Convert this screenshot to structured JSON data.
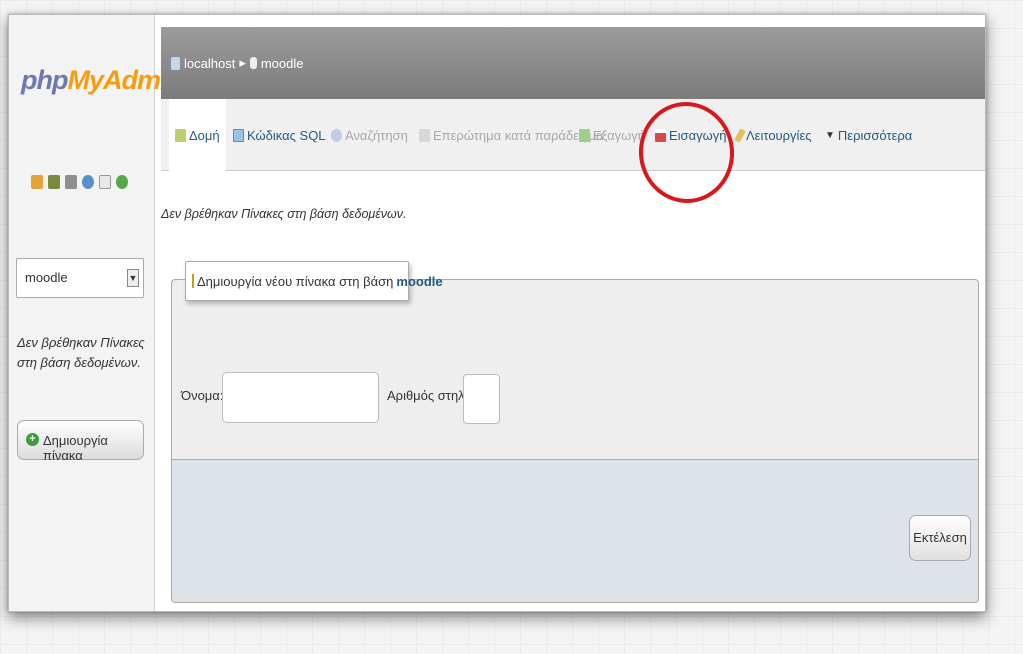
{
  "sidebar": {
    "logo": {
      "php": "php",
      "my": "My",
      "admin": "Admin"
    },
    "db_select_value": "moodle",
    "no_tables_msg": "Δεν βρέθηκαν Πίνακες στη βάση δεδομένων.",
    "create_table_label": "Δημιουργία πίνακα"
  },
  "breadcrumb": {
    "server": "localhost",
    "database": "moodle"
  },
  "tabs": [
    {
      "label": "Δομή",
      "icon": "structure-icon",
      "state": "active"
    },
    {
      "label": "Κώδικας SQL",
      "icon": "sql-icon",
      "state": "normal"
    },
    {
      "label": "Αναζήτηση",
      "icon": "search-icon",
      "state": "disabled"
    },
    {
      "label": "Επερώτημα κατά παράδειγμα",
      "icon": "query-icon",
      "state": "disabled"
    },
    {
      "label": "Εξαγωγή",
      "icon": "export-icon",
      "state": "disabled"
    },
    {
      "label": "Εισαγωγή",
      "icon": "import-icon",
      "state": "normal"
    },
    {
      "label": "Λειτουργίες",
      "icon": "operations-icon",
      "state": "normal"
    },
    {
      "label": "Περισσότερα",
      "icon": "triangle-down-icon",
      "state": "normal"
    }
  ],
  "main": {
    "no_tables_msg": "Δεν βρέθηκαν Πίνακες στη βάση δεδομένων.",
    "create_legend": "Δημιουργία νέου πίνακα στη βάση",
    "create_db": "moodle",
    "name_label": "Όνομα:",
    "cols_label": "Αριθμός στηλών:",
    "go_label": "Εκτέλεση"
  },
  "colors": {
    "accent": "#235a81",
    "highlight": "#d7191c",
    "logo_orange": "#f89c0e",
    "logo_blue": "#6c78af"
  }
}
